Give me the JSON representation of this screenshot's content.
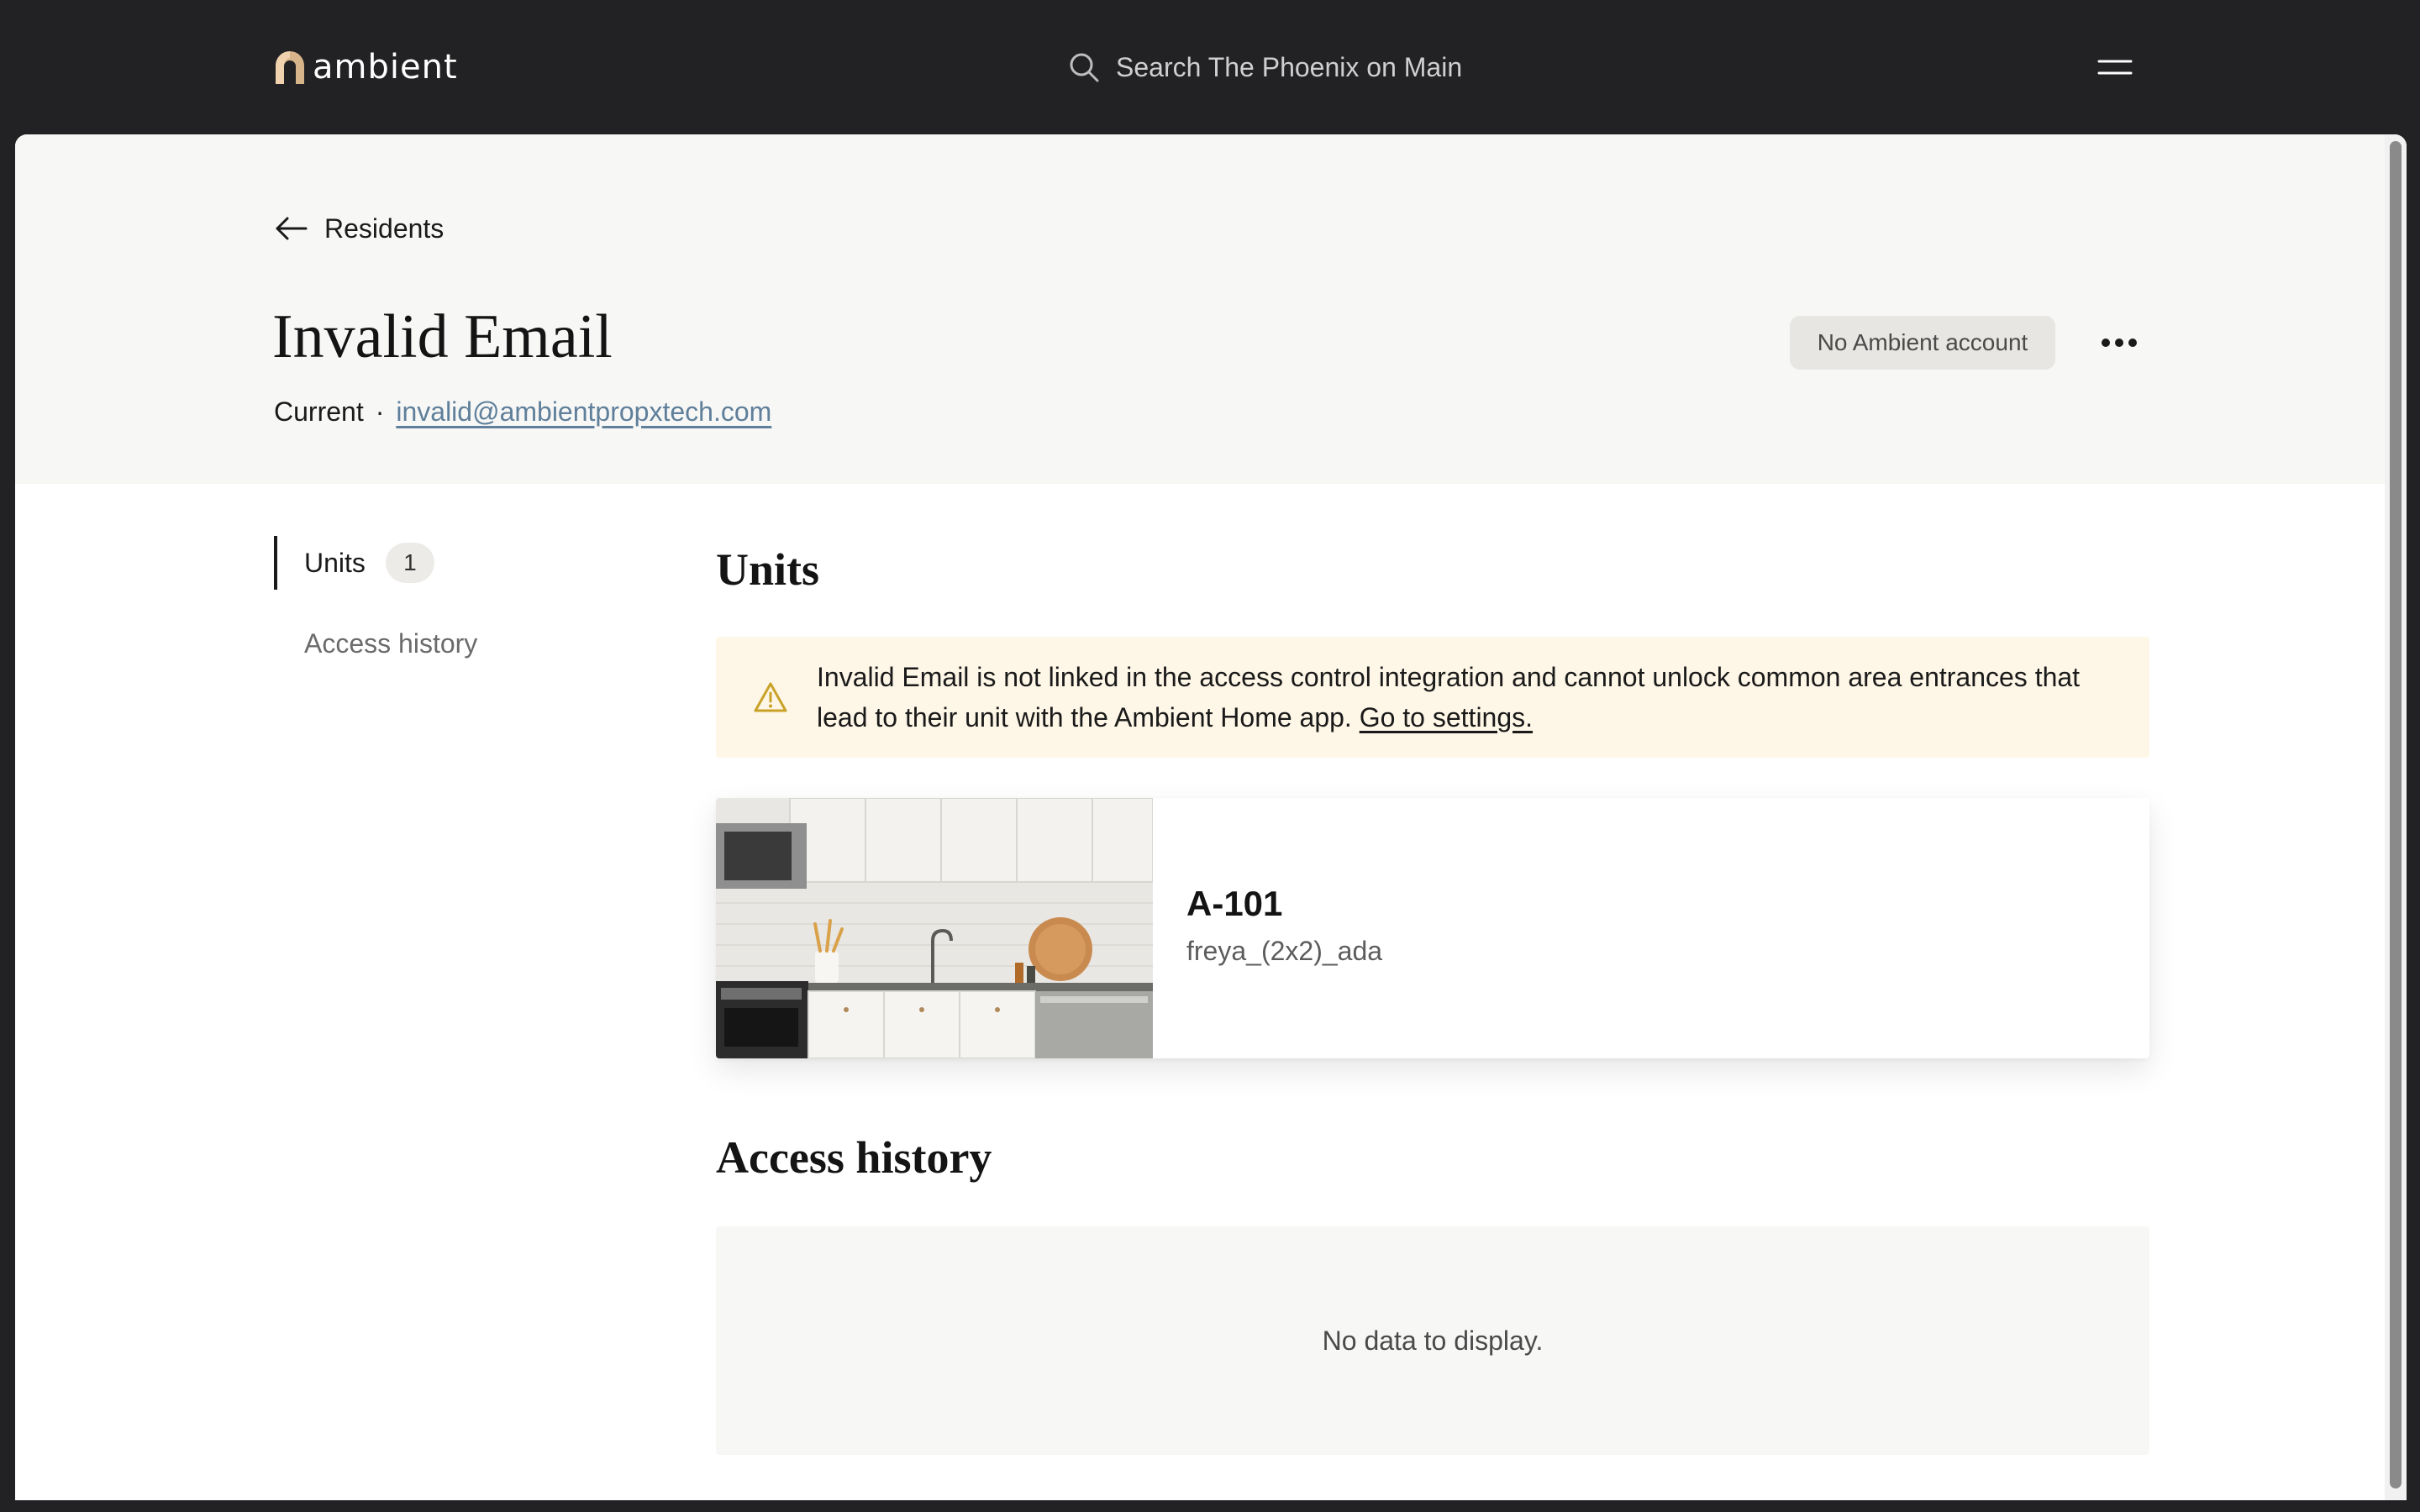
{
  "header": {
    "logo_text": "ambient",
    "logo_icon": "ambient-arch-logo",
    "search_placeholder": "Search The Phoenix on Main",
    "menu_icon": "hamburger-menu-icon"
  },
  "breadcrumb": {
    "back_label": "Residents",
    "back_icon": "arrow-left-icon"
  },
  "resident": {
    "name": "Invalid Email",
    "status": "Current",
    "separator": "·",
    "email": "invalid@ambientpropxtech.com",
    "account_badge": "No Ambient account",
    "more_icon": "ellipsis-icon"
  },
  "sidenav": {
    "items": [
      {
        "label": "Units",
        "count": "1",
        "active": true
      },
      {
        "label": "Access history",
        "active": false
      }
    ]
  },
  "units_section": {
    "title": "Units",
    "alert": {
      "icon": "warning-icon",
      "text": "Invalid Email is not linked in the access control integration and cannot unlock common area entrances that lead to their unit with the Ambient Home app.",
      "link_text": "Go to settings."
    },
    "unit_card": {
      "photo": "kitchen-photo",
      "name": "A-101",
      "floorplan": "freya_(2x2)_ada"
    }
  },
  "access_history": {
    "title": "Access history",
    "empty_text": "No data to display."
  },
  "colors": {
    "topbar": "#222224",
    "hero_bg": "#f7f7f6",
    "link": "#5f7f9a",
    "alert_bg": "#fef6e6",
    "warning": "#c9a227",
    "logo_accent": "#d8b48a"
  }
}
